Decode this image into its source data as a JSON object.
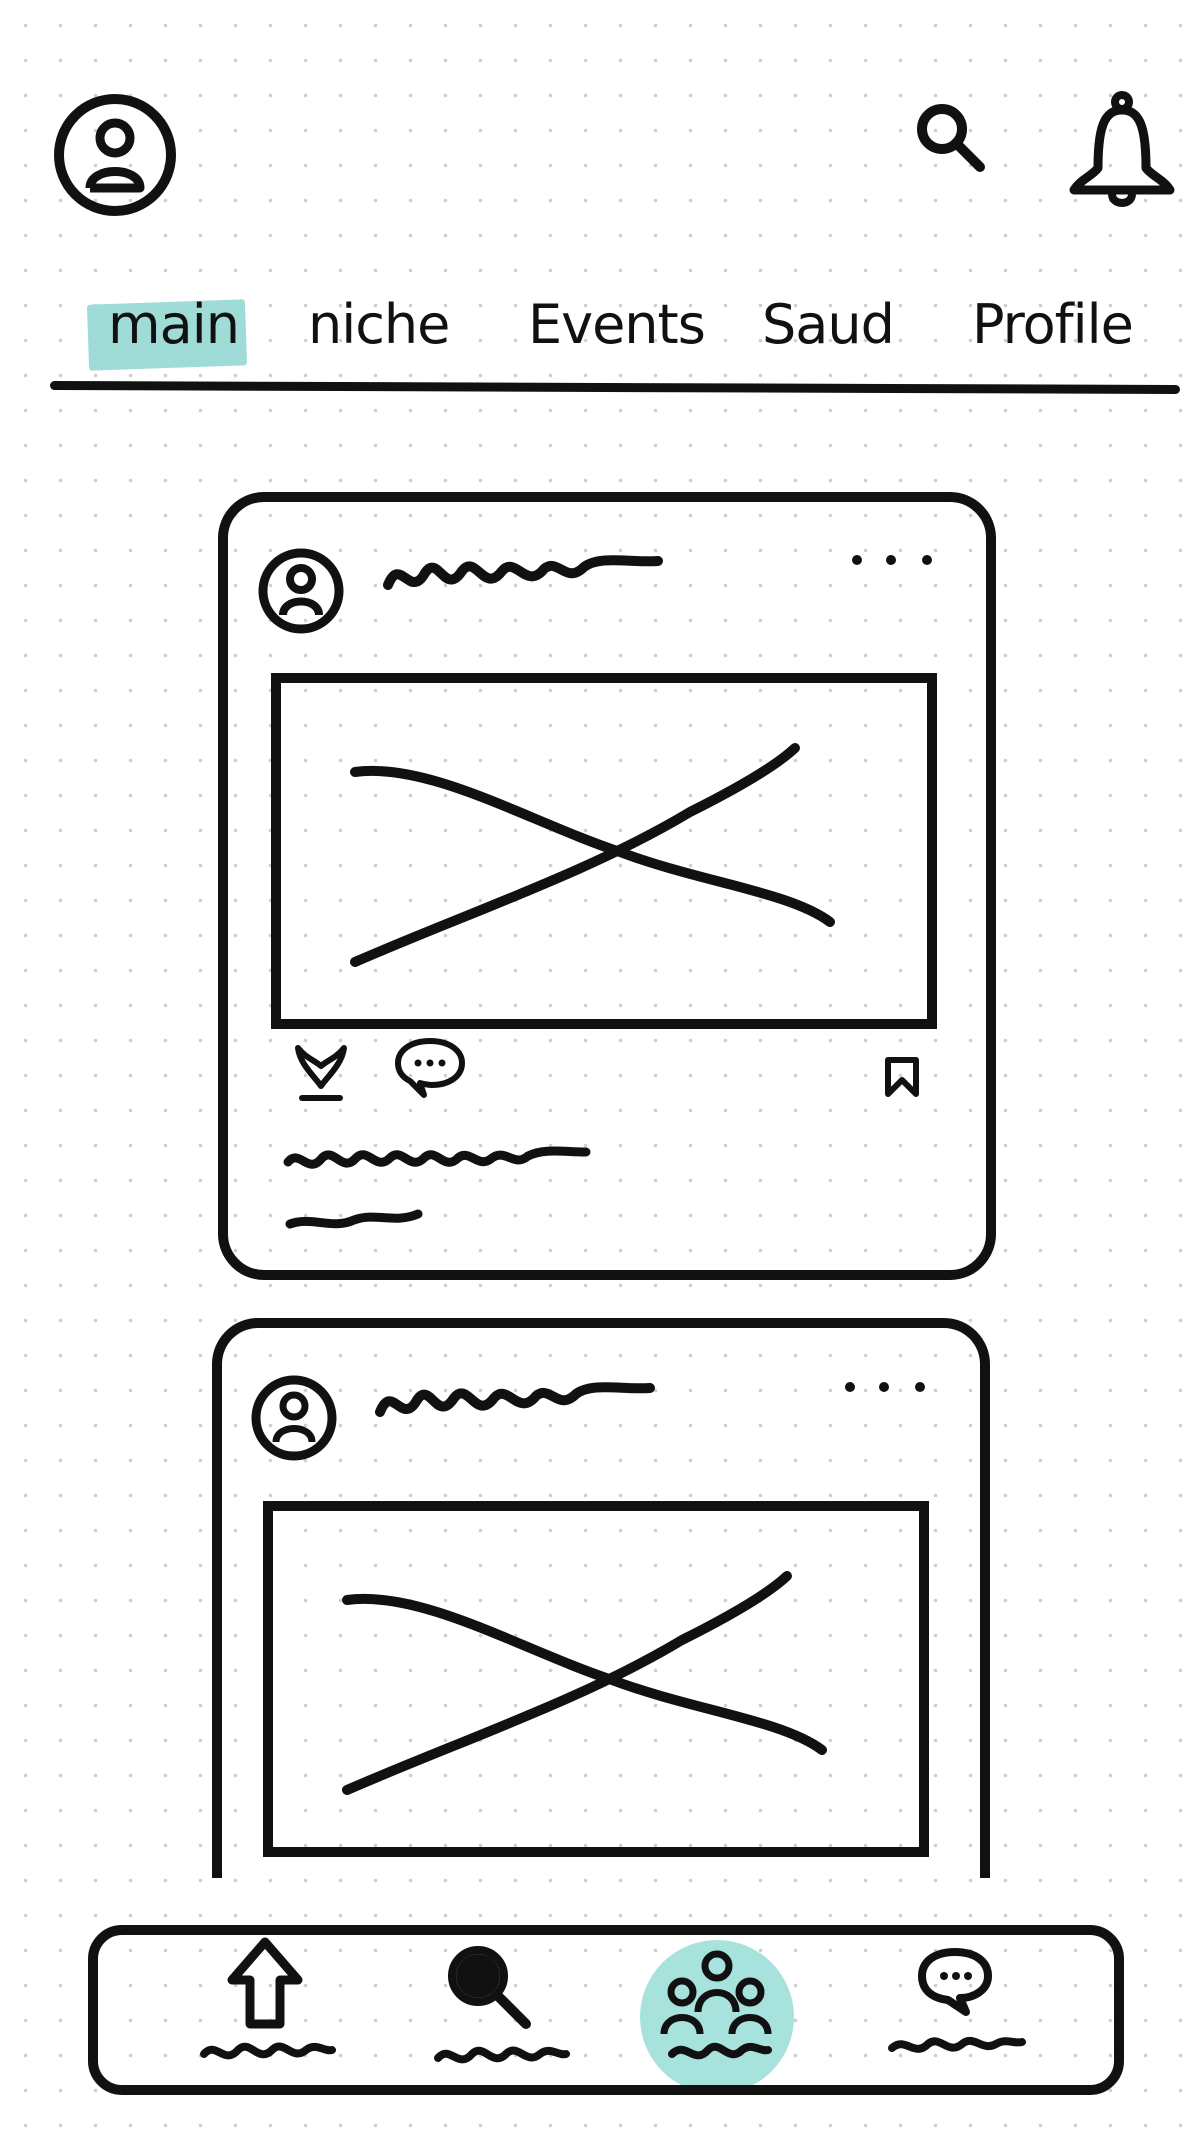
{
  "header": {
    "avatar_icon": "user-avatar-icon",
    "search_icon": "search-icon",
    "notifications_icon": "bell-icon"
  },
  "tabs": [
    {
      "label": "main",
      "active": true
    },
    {
      "label": "niche",
      "active": false
    },
    {
      "label": "Events",
      "active": false
    },
    {
      "label": "Saud",
      "active": false
    },
    {
      "label": "Profile",
      "active": false
    }
  ],
  "posts": [
    {
      "author_icon": "user-avatar-icon",
      "menu_icon": "more-horizontal-icon",
      "image_icon": "image-placeholder-icon",
      "actions": [
        "heart-icon",
        "comment-icon",
        "bookmark-icon"
      ]
    },
    {
      "author_icon": "user-avatar-icon",
      "menu_icon": "more-horizontal-icon",
      "image_icon": "image-placeholder-icon"
    }
  ],
  "bottom_nav": [
    {
      "icon": "home-arrow-icon",
      "active": false
    },
    {
      "icon": "search-icon",
      "active": false
    },
    {
      "icon": "community-icon",
      "active": true
    },
    {
      "icon": "chat-icon",
      "active": false
    }
  ],
  "colors": {
    "accent": "#9fdcd7",
    "ink": "#111111",
    "background": "#ffffff"
  }
}
